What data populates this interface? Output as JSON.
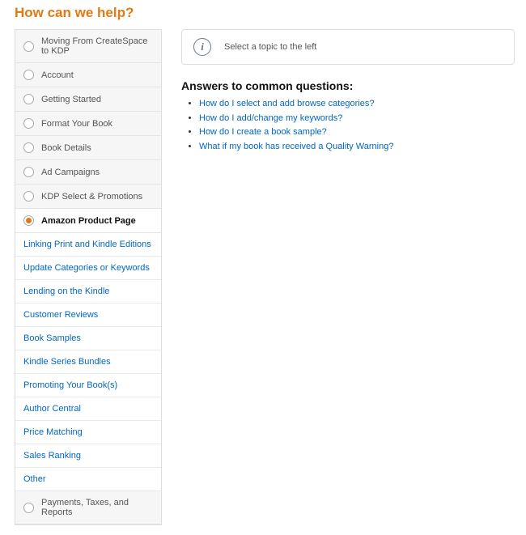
{
  "page": {
    "title": "How can we help?"
  },
  "sidebar": {
    "categories": [
      {
        "label": "Moving From CreateSpace to KDP",
        "selected": false
      },
      {
        "label": "Account",
        "selected": false
      },
      {
        "label": "Getting Started",
        "selected": false
      },
      {
        "label": "Format Your Book",
        "selected": false
      },
      {
        "label": "Book Details",
        "selected": false
      },
      {
        "label": "Ad Campaigns",
        "selected": false
      },
      {
        "label": "KDP Select & Promotions",
        "selected": false
      },
      {
        "label": "Amazon Product Page",
        "selected": true
      },
      {
        "label": "Payments, Taxes, and Reports",
        "selected": false
      }
    ],
    "subitems": [
      {
        "label": "Linking Print and Kindle Editions"
      },
      {
        "label": "Update Categories or Keywords"
      },
      {
        "label": "Lending on the Kindle"
      },
      {
        "label": "Customer Reviews"
      },
      {
        "label": "Book Samples"
      },
      {
        "label": "Kindle Series Bundles"
      },
      {
        "label": "Promoting Your Book(s)"
      },
      {
        "label": "Author Central"
      },
      {
        "label": "Price Matching"
      },
      {
        "label": "Sales Ranking"
      },
      {
        "label": "Other"
      }
    ]
  },
  "main": {
    "info_text": "Select a topic to the left",
    "answers_heading": "Answers to common questions:",
    "answers": [
      "How do I select and add browse categories?",
      "How do I add/change my keywords?",
      "How do I create a book sample?",
      "What if my book has received a Quality Warning?"
    ]
  }
}
